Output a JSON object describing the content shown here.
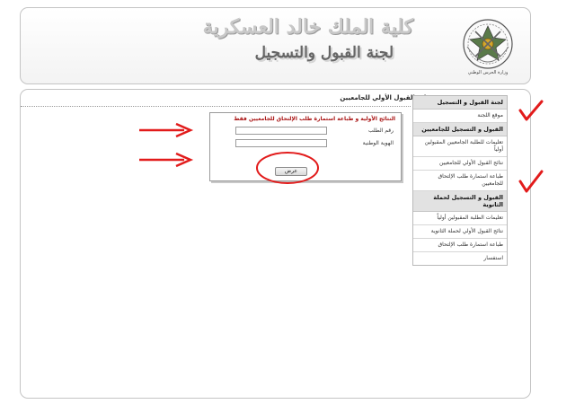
{
  "header": {
    "title": "كلية الملك خالد العسكرية",
    "subtitle": "لجنة القبول والتسجيل",
    "emblem_caption": "وزارة الحرس الوطني"
  },
  "main": {
    "page_title": "نتائج القبول الأولي للجامعيين"
  },
  "form": {
    "notice": "النتائج الأولية و طباعة استمارة طلب الإلتحاق للجامعيين فقط",
    "application_number_label": "رقم الطلب",
    "national_id_label": "الهوية الوطنية",
    "application_number_value": "",
    "national_id_value": "",
    "submit_label": "عرض"
  },
  "sidebar": {
    "group1_title": "لجنة القبول و التسجيل",
    "group1_items": [
      "موقع اللجنة"
    ],
    "group2_title": "القبول و التسجيل للجامعيين",
    "group2_items": [
      "تعليمات للطلبة الجامعيين المقبولين أولياً",
      "نتائج القبول الأولي للجامعيين",
      "طباعة استمارة طلب الإلتحاق للجامعيين"
    ],
    "group3_title": "القبول و التسجيل لحملة الثانوية",
    "group3_items": [
      "تعليمات الطلبة المقبولين أولياً",
      "نتائج القبول الأولي لحملة الثانوية",
      "طباعة استمارة طلب الإلتحاق",
      "استفسار"
    ]
  },
  "colors": {
    "annotation_red": "#e21b1b",
    "notice_red": "#a81010",
    "sidebar_header_bg": "#e2e2e2"
  }
}
